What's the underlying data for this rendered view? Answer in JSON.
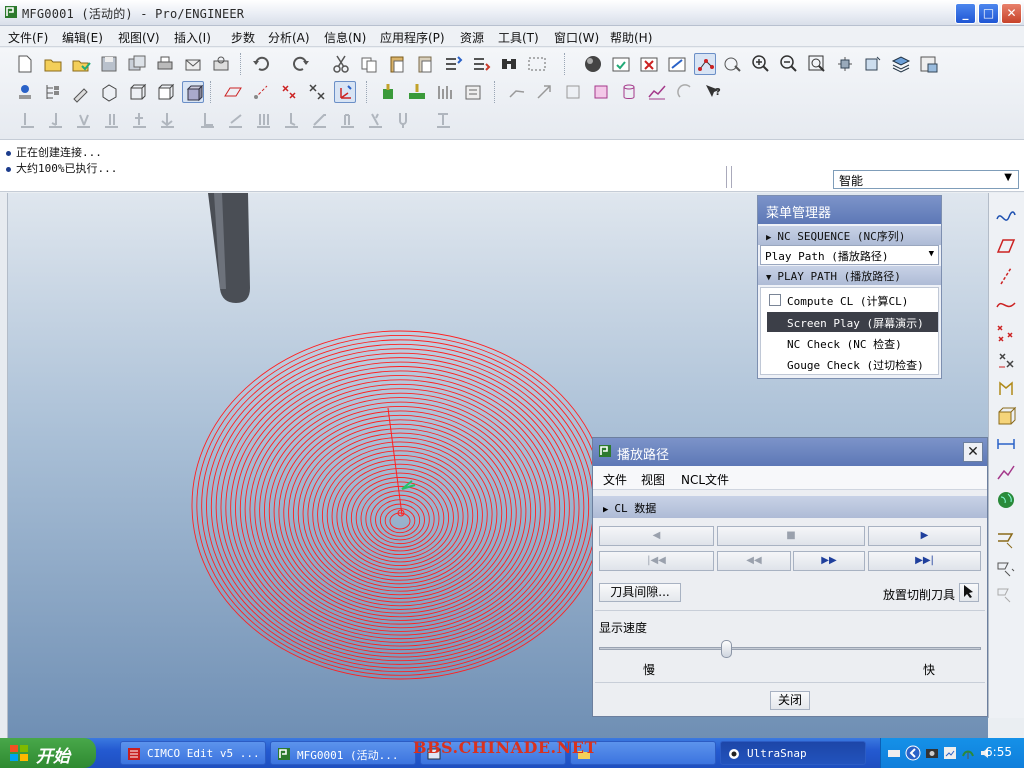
{
  "window": {
    "title": "MFG0001 (活动的) - Pro/ENGINEER",
    "minimize": "_",
    "maximize": "□",
    "close": "✕"
  },
  "menubar": {
    "items": [
      "文件(F)",
      "编辑(E)",
      "视图(V)",
      "插入(I)",
      "步数",
      "分析(A)",
      "信息(N)",
      "应用程序(P)",
      "资源",
      "工具(T)",
      "窗口(W)",
      "帮助(H)"
    ]
  },
  "messages": {
    "line1": "正在创建连接...",
    "line2": "大约100%已执行..."
  },
  "filter": {
    "value": "智能",
    "arrow": "▼"
  },
  "menu_manager": {
    "title": "菜单管理器",
    "section_nc": "NC SEQUENCE (NC序列)",
    "dropdown_value": "Play Path (播放路径)",
    "section_play": "PLAY PATH (播放路径)",
    "items": {
      "compute_cl": "Compute CL (计算CL)",
      "screen_play": "Screen Play (屏幕演示)",
      "nc_check": "NC Check (NC 检查)",
      "gouge_check": "Gouge Check (过切检查)"
    }
  },
  "play_dialog": {
    "title": "播放路径",
    "close_x": "✕",
    "menu": {
      "file": "文件",
      "view": "视图",
      "ncl": "NCL文件"
    },
    "section_cl": "CL 数据",
    "controls": {
      "reverse": "◀",
      "stop": "■",
      "play": "▶",
      "rewind_start": "|◀◀",
      "step_back": "◀◀",
      "step_forward": "▶▶",
      "forward_end": "▶▶|"
    },
    "tool_clearance": "刀具间隙...",
    "place_tool": "放置切削刀具",
    "speed_label": "显示速度",
    "slow": "慢",
    "fast": "快",
    "speed_value": 0.33,
    "close_button": "关闭"
  },
  "taskbar": {
    "start": "开始",
    "tasks": {
      "cimco": "CIMCO Edit v5 ...",
      "proe": "MFG0001 (活动...",
      "ultrasnap": "UltraSnap"
    },
    "watermark": "BBS.CHINADE.NET",
    "clock": "6:55"
  },
  "colors": {
    "toolpath": "#ff2020",
    "viewport_top": "#dfe6ee",
    "viewport_bottom": "#6f8fb4",
    "title_blue": "#5d78b6"
  }
}
